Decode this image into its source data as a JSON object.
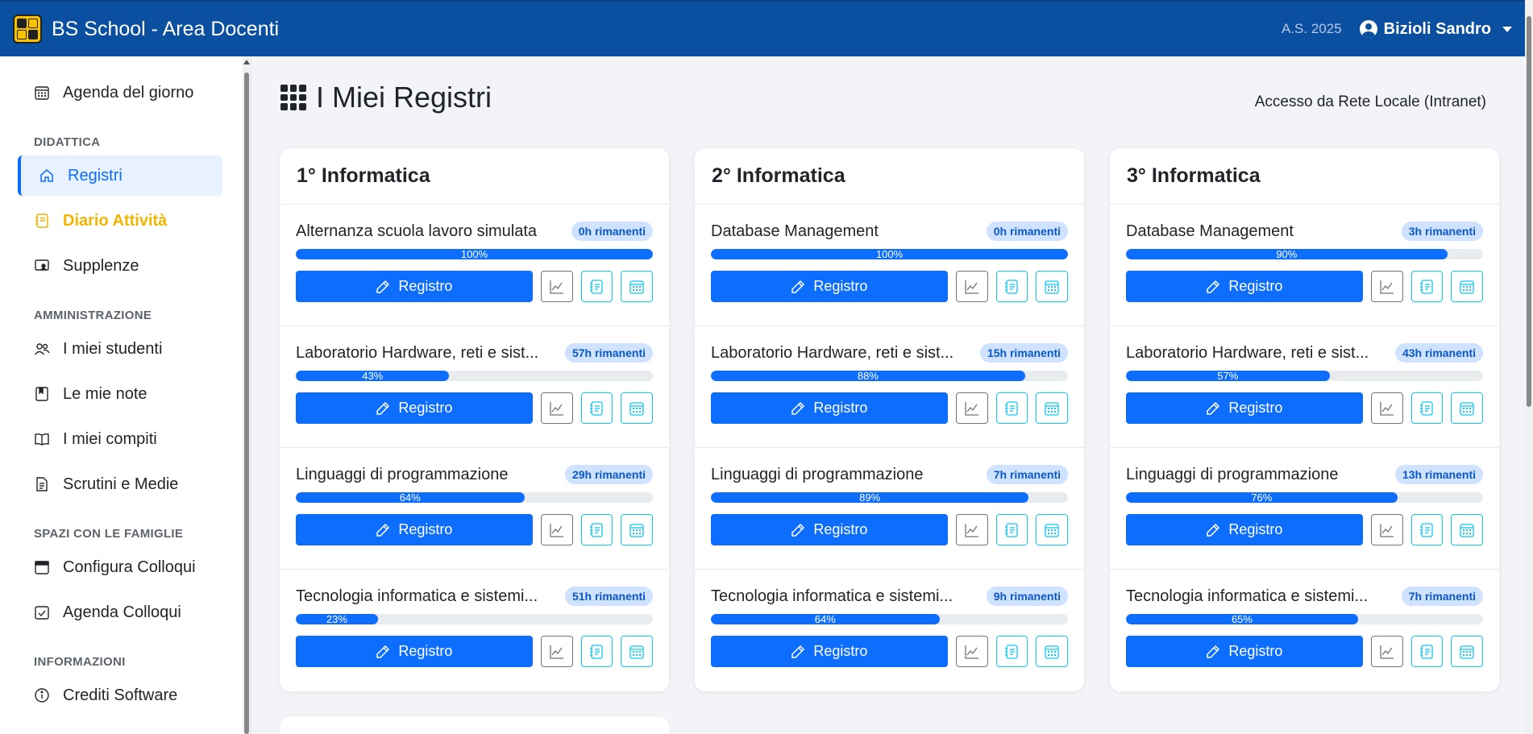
{
  "navbar": {
    "title": "BS School - Area Docenti",
    "year": "A.S. 2025",
    "user": "Bizioli Sandro"
  },
  "sidebar": {
    "items": [
      {
        "label": "Agenda del giorno",
        "icon": "calendar-icon"
      },
      {
        "section": "DIDATTICA"
      },
      {
        "label": "Registri",
        "icon": "house-icon",
        "active": true
      },
      {
        "label": "Diario Attività",
        "icon": "journal-icon",
        "highlight": true
      },
      {
        "label": "Supplenze",
        "icon": "person-screen-icon"
      },
      {
        "section": "AMMINISTRAZIONE"
      },
      {
        "label": "I miei studenti",
        "icon": "people-icon"
      },
      {
        "label": "Le mie note",
        "icon": "bookmark-book-icon"
      },
      {
        "label": "I miei compiti",
        "icon": "book-icon"
      },
      {
        "label": "Scrutini e Medie",
        "icon": "document-icon"
      },
      {
        "section": "SPAZI CON LE FAMIGLIE"
      },
      {
        "label": "Configura Colloqui",
        "icon": "calendar-blank-icon"
      },
      {
        "label": "Agenda Colloqui",
        "icon": "calendar-check-icon"
      },
      {
        "section": "INFORMAZIONI"
      },
      {
        "label": "Crediti Software",
        "icon": "info-circle-icon"
      }
    ]
  },
  "main": {
    "title": "I Miei Registri",
    "access": "Accesso da Rete Locale (Intranet)",
    "button_label": "Registro",
    "colors": {
      "primary": "#0d6efd",
      "navbar": "#0b4fa0",
      "badge_bg": "#cfe2ff",
      "highlight": "#f4b400"
    },
    "classes": [
      {
        "name": "1° Informatica",
        "subjects": [
          {
            "name": "Alternanza scuola lavoro simulata",
            "remaining": "0h rimanenti",
            "percent": 100,
            "percent_label": "100%"
          },
          {
            "name": "Laboratorio Hardware, reti e sist...",
            "remaining": "57h rimanenti",
            "percent": 43,
            "percent_label": "43%"
          },
          {
            "name": "Linguaggi di programmazione",
            "remaining": "29h rimanenti",
            "percent": 64,
            "percent_label": "64%"
          },
          {
            "name": "Tecnologia informatica e sistemi...",
            "remaining": "51h rimanenti",
            "percent": 23,
            "percent_label": "23%"
          }
        ]
      },
      {
        "name": "2° Informatica",
        "subjects": [
          {
            "name": "Database Management",
            "remaining": "0h rimanenti",
            "percent": 100,
            "percent_label": "100%"
          },
          {
            "name": "Laboratorio Hardware, reti e sist...",
            "remaining": "15h rimanenti",
            "percent": 88,
            "percent_label": "88%"
          },
          {
            "name": "Linguaggi di programmazione",
            "remaining": "7h rimanenti",
            "percent": 89,
            "percent_label": "89%"
          },
          {
            "name": "Tecnologia informatica e sistemi...",
            "remaining": "9h rimanenti",
            "percent": 64,
            "percent_label": "64%"
          }
        ]
      },
      {
        "name": "3° Informatica",
        "subjects": [
          {
            "name": "Database Management",
            "remaining": "3h rimanenti",
            "percent": 90,
            "percent_label": "90%"
          },
          {
            "name": "Laboratorio Hardware, reti e sist...",
            "remaining": "43h rimanenti",
            "percent": 57,
            "percent_label": "57%"
          },
          {
            "name": "Linguaggi di programmazione",
            "remaining": "13h rimanenti",
            "percent": 76,
            "percent_label": "76%"
          },
          {
            "name": "Tecnologia informatica e sistemi...",
            "remaining": "7h rimanenti",
            "percent": 65,
            "percent_label": "65%"
          }
        ]
      }
    ]
  }
}
